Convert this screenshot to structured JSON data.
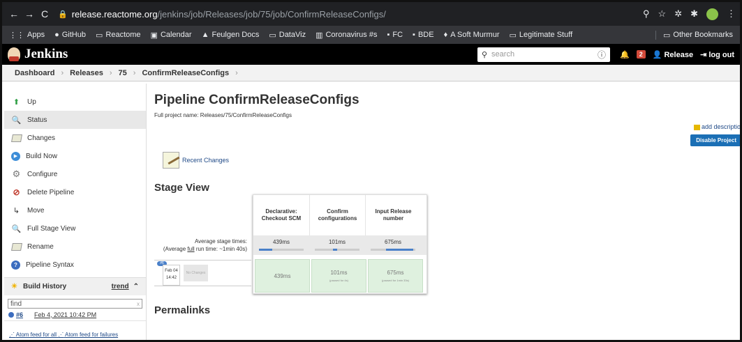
{
  "browser": {
    "url_host": "release.reactome.org",
    "url_path": "/jenkins/job/Releases/job/75/job/ConfirmReleaseConfigs/",
    "bookmarks": [
      "Apps",
      "GitHub",
      "Reactome",
      "Calendar",
      "Feulgen Docs",
      "DataViz",
      "Coronavirus #s",
      "FC",
      "BDE",
      "A Soft Murmur",
      "Legitimate Stuff"
    ],
    "other_bookmarks": "Other Bookmarks"
  },
  "header": {
    "logo": "Jenkins",
    "search_placeholder": "search",
    "notification_count": "2",
    "user": "Release",
    "logout": "log out"
  },
  "breadcrumbs": [
    "Dashboard",
    "Releases",
    "75",
    "ConfirmReleaseConfigs"
  ],
  "sidebar": {
    "tasks": [
      {
        "label": "Up",
        "icon": "up-arrow-icon"
      },
      {
        "label": "Status",
        "icon": "magnifier-icon"
      },
      {
        "label": "Changes",
        "icon": "notepad-icon"
      },
      {
        "label": "Build Now",
        "icon": "clock-icon"
      },
      {
        "label": "Configure",
        "icon": "gear-icon"
      },
      {
        "label": "Delete Pipeline",
        "icon": "no-entry-icon"
      },
      {
        "label": "Move",
        "icon": "move-icon"
      },
      {
        "label": "Full Stage View",
        "icon": "magnifier-icon"
      },
      {
        "label": "Rename",
        "icon": "notepad-icon"
      },
      {
        "label": "Pipeline Syntax",
        "icon": "help-icon"
      }
    ],
    "build_history": "Build History",
    "trend": "trend",
    "find_placeholder": "find",
    "builds": [
      {
        "number": "#6",
        "date": "Feb 4, 2021 10:42 PM"
      }
    ],
    "feed_all": "Atom feed for all",
    "feed_failures": "Atom feed for failures"
  },
  "main": {
    "title": "Pipeline ConfirmReleaseConfigs",
    "full_name": "Full project name: Releases/75/ConfirmReleaseConfigs",
    "add_description": "add description",
    "disable_project": "Disable Project",
    "recent_changes": "Recent Changes",
    "stage_view_title": "Stage View",
    "avg_stage_times": "Average stage times:",
    "avg_run_pre": "(Average ",
    "avg_run_link": "full",
    "avg_run_post": " run time: ~1min 40s)",
    "permalinks": "Permalinks"
  },
  "stage_view": {
    "stages": [
      {
        "name": "Declarative: Checkout SCM",
        "avg": "439ms",
        "avg_fraction": 0.3
      },
      {
        "name": "Confirm configurations",
        "avg": "101ms",
        "avg_fraction": 0.1
      },
      {
        "name": "Input Release number",
        "avg": "675ms",
        "avg_fraction": 0.6
      }
    ],
    "build": {
      "badge": "#6",
      "month_day": "Feb 04",
      "time": "14:42",
      "changes": "No Changes",
      "cells": [
        {
          "time": "439ms",
          "note": ""
        },
        {
          "time": "101ms",
          "note": "(paused for 4s)"
        },
        {
          "time": "675ms",
          "note": "(paused for 1min 33s)"
        }
      ]
    }
  }
}
